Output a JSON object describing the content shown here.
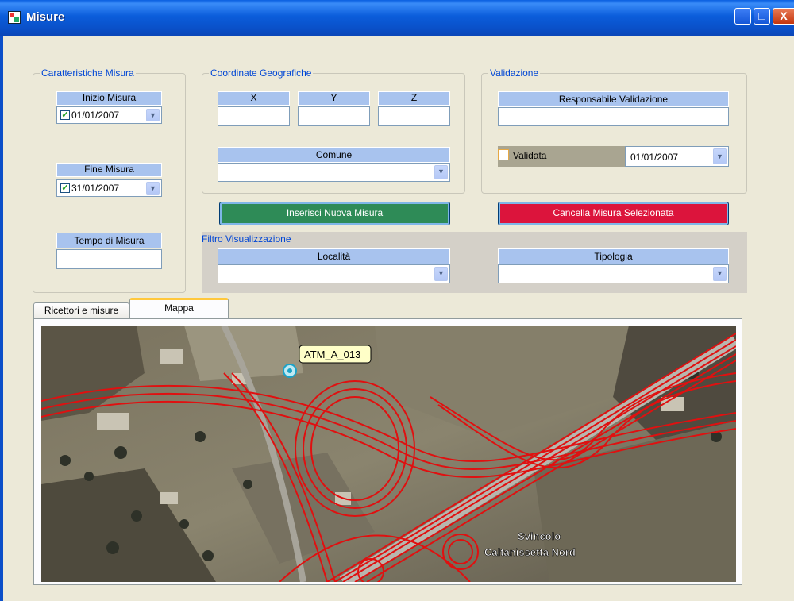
{
  "window": {
    "title": "Misure",
    "icon": "app-window-icon"
  },
  "title_buttons": {
    "minimize": "_",
    "maximize": "□",
    "close": "X"
  },
  "caratteristiche": {
    "label": "Caratteristiche Misura",
    "inizio_label": "Inizio Misura",
    "inizio_value": "01/01/2007",
    "inizio_checked": true,
    "fine_label": "Fine Misura",
    "fine_value": "31/01/2007",
    "fine_checked": true,
    "tempo_label": "Tempo di Misura",
    "tempo_value": ""
  },
  "coordinate": {
    "label": "Coordinate Geografiche",
    "x_label": "X",
    "y_label": "Y",
    "z_label": "Z",
    "x_value": "",
    "y_value": "",
    "z_value": "",
    "comune_label": "Comune",
    "comune_value": ""
  },
  "validazione": {
    "label": "Validazione",
    "responsabile_label": "Responsabile Validazione",
    "responsabile_value": "",
    "validata_label": "Validata",
    "validata_checked": false,
    "date_value": "01/01/2007"
  },
  "buttons": {
    "inserisci": "Inserisci Nuova Misura",
    "cancella": "Cancella Misura Selezionata",
    "inserisci_color": "#2E8B57",
    "cancella_color": "#DC143C"
  },
  "filtro": {
    "label": "Filtro Visualizzazione",
    "localita_label": "Località",
    "localita_value": "",
    "tipologia_label": "Tipologia",
    "tipologia_value": ""
  },
  "tabs": [
    {
      "label": "Ricettori e misure",
      "active": false
    },
    {
      "label": "Mappa",
      "active": true
    }
  ],
  "map": {
    "marker_label": "ATM_A_013",
    "marker_icon": "map-marker-icon",
    "place_line1": "Svincolo",
    "place_line2": "Caltanissetta Nord",
    "road_color": "#E01010"
  }
}
